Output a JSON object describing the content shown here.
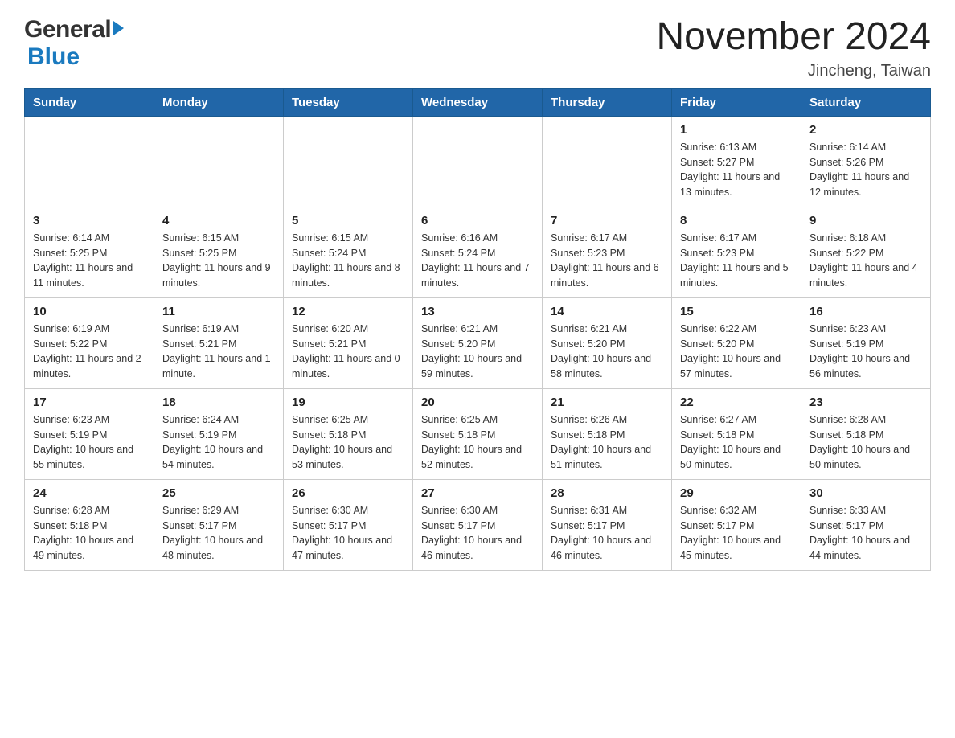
{
  "header": {
    "logo_general": "General",
    "logo_blue": "Blue",
    "title": "November 2024",
    "subtitle": "Jincheng, Taiwan"
  },
  "calendar": {
    "days_of_week": [
      "Sunday",
      "Monday",
      "Tuesday",
      "Wednesday",
      "Thursday",
      "Friday",
      "Saturday"
    ],
    "weeks": [
      [
        {
          "day": "",
          "info": ""
        },
        {
          "day": "",
          "info": ""
        },
        {
          "day": "",
          "info": ""
        },
        {
          "day": "",
          "info": ""
        },
        {
          "day": "",
          "info": ""
        },
        {
          "day": "1",
          "info": "Sunrise: 6:13 AM\nSunset: 5:27 PM\nDaylight: 11 hours and 13 minutes."
        },
        {
          "day": "2",
          "info": "Sunrise: 6:14 AM\nSunset: 5:26 PM\nDaylight: 11 hours and 12 minutes."
        }
      ],
      [
        {
          "day": "3",
          "info": "Sunrise: 6:14 AM\nSunset: 5:25 PM\nDaylight: 11 hours and 11 minutes."
        },
        {
          "day": "4",
          "info": "Sunrise: 6:15 AM\nSunset: 5:25 PM\nDaylight: 11 hours and 9 minutes."
        },
        {
          "day": "5",
          "info": "Sunrise: 6:15 AM\nSunset: 5:24 PM\nDaylight: 11 hours and 8 minutes."
        },
        {
          "day": "6",
          "info": "Sunrise: 6:16 AM\nSunset: 5:24 PM\nDaylight: 11 hours and 7 minutes."
        },
        {
          "day": "7",
          "info": "Sunrise: 6:17 AM\nSunset: 5:23 PM\nDaylight: 11 hours and 6 minutes."
        },
        {
          "day": "8",
          "info": "Sunrise: 6:17 AM\nSunset: 5:23 PM\nDaylight: 11 hours and 5 minutes."
        },
        {
          "day": "9",
          "info": "Sunrise: 6:18 AM\nSunset: 5:22 PM\nDaylight: 11 hours and 4 minutes."
        }
      ],
      [
        {
          "day": "10",
          "info": "Sunrise: 6:19 AM\nSunset: 5:22 PM\nDaylight: 11 hours and 2 minutes."
        },
        {
          "day": "11",
          "info": "Sunrise: 6:19 AM\nSunset: 5:21 PM\nDaylight: 11 hours and 1 minute."
        },
        {
          "day": "12",
          "info": "Sunrise: 6:20 AM\nSunset: 5:21 PM\nDaylight: 11 hours and 0 minutes."
        },
        {
          "day": "13",
          "info": "Sunrise: 6:21 AM\nSunset: 5:20 PM\nDaylight: 10 hours and 59 minutes."
        },
        {
          "day": "14",
          "info": "Sunrise: 6:21 AM\nSunset: 5:20 PM\nDaylight: 10 hours and 58 minutes."
        },
        {
          "day": "15",
          "info": "Sunrise: 6:22 AM\nSunset: 5:20 PM\nDaylight: 10 hours and 57 minutes."
        },
        {
          "day": "16",
          "info": "Sunrise: 6:23 AM\nSunset: 5:19 PM\nDaylight: 10 hours and 56 minutes."
        }
      ],
      [
        {
          "day": "17",
          "info": "Sunrise: 6:23 AM\nSunset: 5:19 PM\nDaylight: 10 hours and 55 minutes."
        },
        {
          "day": "18",
          "info": "Sunrise: 6:24 AM\nSunset: 5:19 PM\nDaylight: 10 hours and 54 minutes."
        },
        {
          "day": "19",
          "info": "Sunrise: 6:25 AM\nSunset: 5:18 PM\nDaylight: 10 hours and 53 minutes."
        },
        {
          "day": "20",
          "info": "Sunrise: 6:25 AM\nSunset: 5:18 PM\nDaylight: 10 hours and 52 minutes."
        },
        {
          "day": "21",
          "info": "Sunrise: 6:26 AM\nSunset: 5:18 PM\nDaylight: 10 hours and 51 minutes."
        },
        {
          "day": "22",
          "info": "Sunrise: 6:27 AM\nSunset: 5:18 PM\nDaylight: 10 hours and 50 minutes."
        },
        {
          "day": "23",
          "info": "Sunrise: 6:28 AM\nSunset: 5:18 PM\nDaylight: 10 hours and 50 minutes."
        }
      ],
      [
        {
          "day": "24",
          "info": "Sunrise: 6:28 AM\nSunset: 5:18 PM\nDaylight: 10 hours and 49 minutes."
        },
        {
          "day": "25",
          "info": "Sunrise: 6:29 AM\nSunset: 5:17 PM\nDaylight: 10 hours and 48 minutes."
        },
        {
          "day": "26",
          "info": "Sunrise: 6:30 AM\nSunset: 5:17 PM\nDaylight: 10 hours and 47 minutes."
        },
        {
          "day": "27",
          "info": "Sunrise: 6:30 AM\nSunset: 5:17 PM\nDaylight: 10 hours and 46 minutes."
        },
        {
          "day": "28",
          "info": "Sunrise: 6:31 AM\nSunset: 5:17 PM\nDaylight: 10 hours and 46 minutes."
        },
        {
          "day": "29",
          "info": "Sunrise: 6:32 AM\nSunset: 5:17 PM\nDaylight: 10 hours and 45 minutes."
        },
        {
          "day": "30",
          "info": "Sunrise: 6:33 AM\nSunset: 5:17 PM\nDaylight: 10 hours and 44 minutes."
        }
      ]
    ]
  }
}
